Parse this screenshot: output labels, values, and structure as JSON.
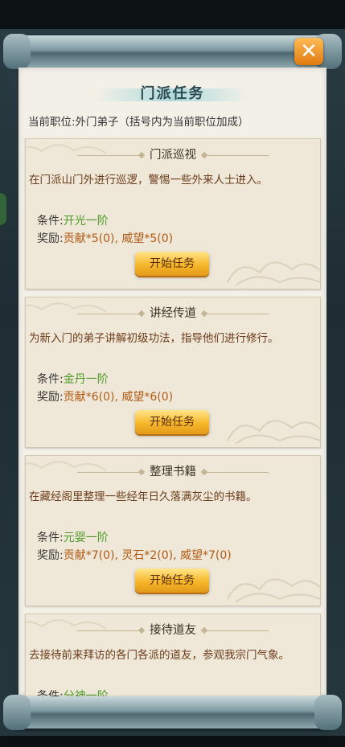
{
  "panel": {
    "title": "门派任务",
    "rank_text": "当前职位:外门弟子（括号内为当前职位加成）"
  },
  "labels": {
    "condition": "条件:",
    "reward": "奖励:"
  },
  "tasks": [
    {
      "name": "门派巡视",
      "desc": "在门派山门外进行巡逻，警惕一些外来人士进入。",
      "condition": "开光一阶",
      "reward": "贡献*5(0), 威望*5(0)",
      "button": "开始任务"
    },
    {
      "name": "讲经传道",
      "desc": "为新入门的弟子讲解初级功法，指导他们进行修行。",
      "condition": "金丹一阶",
      "reward": "贡献*6(0), 威望*6(0)",
      "button": "开始任务"
    },
    {
      "name": "整理书籍",
      "desc": "在藏经阁里整理一些经年日久落满灰尘的书籍。",
      "condition": "元婴一阶",
      "reward": "贡献*7(0), 灵石*2(0), 威望*7(0)",
      "button": "开始任务"
    },
    {
      "name": "接待道友",
      "desc": "去接待前来拜访的各门各派的道友，参观我宗门气象。",
      "condition": "分神一阶",
      "reward": "",
      "button": ""
    }
  ],
  "icons": {
    "close": "close-icon"
  },
  "colors": {
    "condition_value": "#4f9a2a",
    "reward_value": "#b15a14",
    "button": "#f6b72a",
    "close_button": "#f08a18"
  }
}
